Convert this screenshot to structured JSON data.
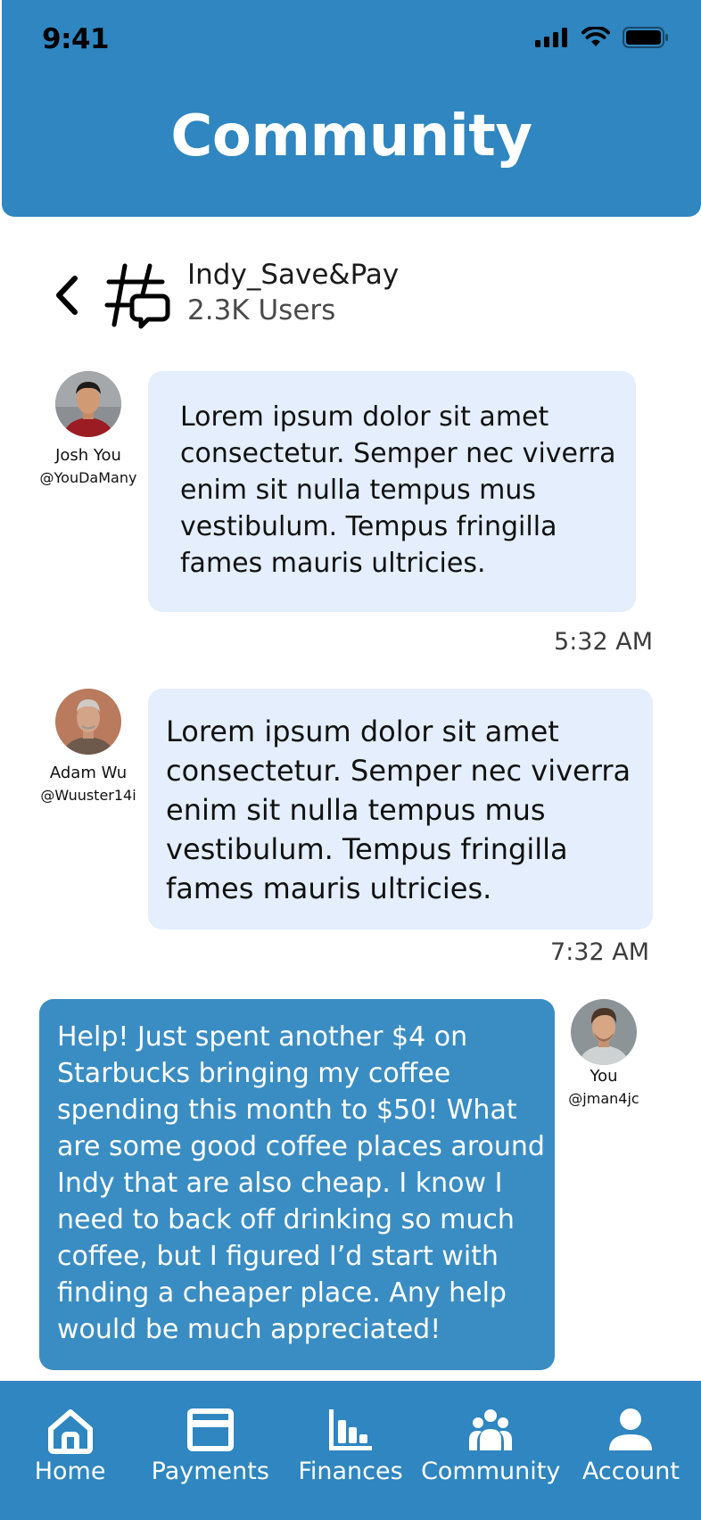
{
  "status_bar": {
    "time": "9:41"
  },
  "header": {
    "title": "Community"
  },
  "group": {
    "name": "Indy_Save&Pay",
    "users": "2.3K Users"
  },
  "messages": [
    {
      "author": "Josh You",
      "handle": "@YouDaMany",
      "text": "Lorem ipsum dolor sit amet\nconsectetur. Semper nec viverra\nenim sit nulla tempus mus\nvestibulum. Tempus fringilla\nfames mauris ultricies.",
      "time": "5:32 AM"
    },
    {
      "author": "Adam Wu",
      "handle": "@Wuuster14i",
      "text": "Lorem ipsum dolor sit amet\nconsectetur. Semper nec viverra\nenim sit nulla tempus mus\nvestibulum. Tempus fringilla\nfames mauris ultricies.",
      "time": "7:32 AM"
    },
    {
      "author": "You",
      "handle": "@jman4jc",
      "text": "Help! Just spent another $4 on\nStarbucks bringing my coffee\nspending this month to $50! What\nare some good coffee places around\nIndy that are also cheap. I know I\nneed to back off drinking so much\ncoffee, but I figured I’d start with\nfinding a cheaper place. Any help\nwould be much appreciated!"
    }
  ],
  "tabs": [
    {
      "label": "Home",
      "icon": "home-icon"
    },
    {
      "label": "Payments",
      "icon": "card-icon"
    },
    {
      "label": "Finances",
      "icon": "bar-chart-icon"
    },
    {
      "label": "Community",
      "icon": "community-icon"
    },
    {
      "label": "Account",
      "icon": "account-icon"
    }
  ],
  "colors": {
    "primary": "#2F86C0",
    "incoming_bubble": "#E4EEFC",
    "outgoing_bubble": "#3A8DC3"
  }
}
